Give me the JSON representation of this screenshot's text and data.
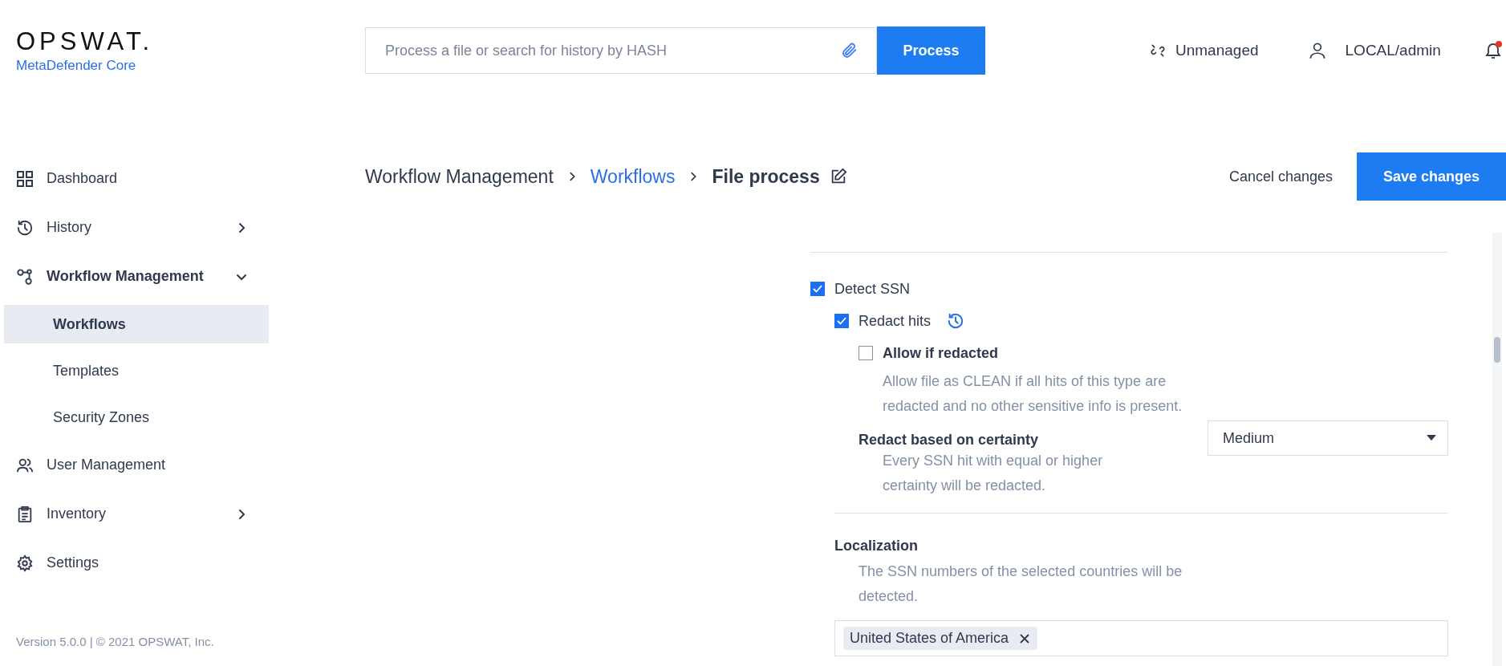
{
  "header": {
    "logo": {
      "wordmark": "OPSWAT.",
      "product": "MetaDefender Core"
    },
    "search": {
      "placeholder": "Process a file or search for history by HASH"
    },
    "process_button": "Process",
    "status": "Unmanaged",
    "user": "LOCAL/admin",
    "notification": true
  },
  "sidebar": {
    "items": [
      {
        "label": "Dashboard",
        "selected": false
      },
      {
        "label": "History",
        "selected": false,
        "expanded": false
      },
      {
        "label": "Workflow Management",
        "selected": false,
        "expanded": true,
        "children": [
          {
            "label": "Workflows",
            "selected": true
          },
          {
            "label": "Templates",
            "selected": false
          },
          {
            "label": "Security Zones",
            "selected": false
          }
        ]
      },
      {
        "label": "User Management",
        "selected": false
      },
      {
        "label": "Inventory",
        "selected": false,
        "expanded": false
      },
      {
        "label": "Settings",
        "selected": false
      }
    ],
    "version": "Version 5.0.0 | © 2021 OPSWAT, Inc."
  },
  "breadcrumb": [
    {
      "label": "Workflow Management",
      "kind": "text"
    },
    {
      "label": "Workflows",
      "kind": "link"
    },
    {
      "label": "File process",
      "kind": "current"
    }
  ],
  "actions": {
    "cancel": "Cancel changes",
    "save": "Save changes"
  },
  "settings": {
    "detect_ssn": {
      "label": "Detect SSN",
      "checked": true
    },
    "redact_hits": {
      "label": "Redact hits",
      "checked": true
    },
    "allow_if_redacted": {
      "label": "Allow if redacted",
      "checked": false,
      "description": "Allow file as CLEAN if all hits of this type are redacted and no other sensitive info is present."
    },
    "certainty": {
      "label": "Redact based on certainty",
      "description": "Every SSN hit with equal or higher certainty will be redacted.",
      "value": "Medium"
    },
    "localization": {
      "label": "Localization",
      "description": "The SSN numbers of the selected countries will be detected.",
      "tags": [
        "United States of America"
      ]
    }
  }
}
